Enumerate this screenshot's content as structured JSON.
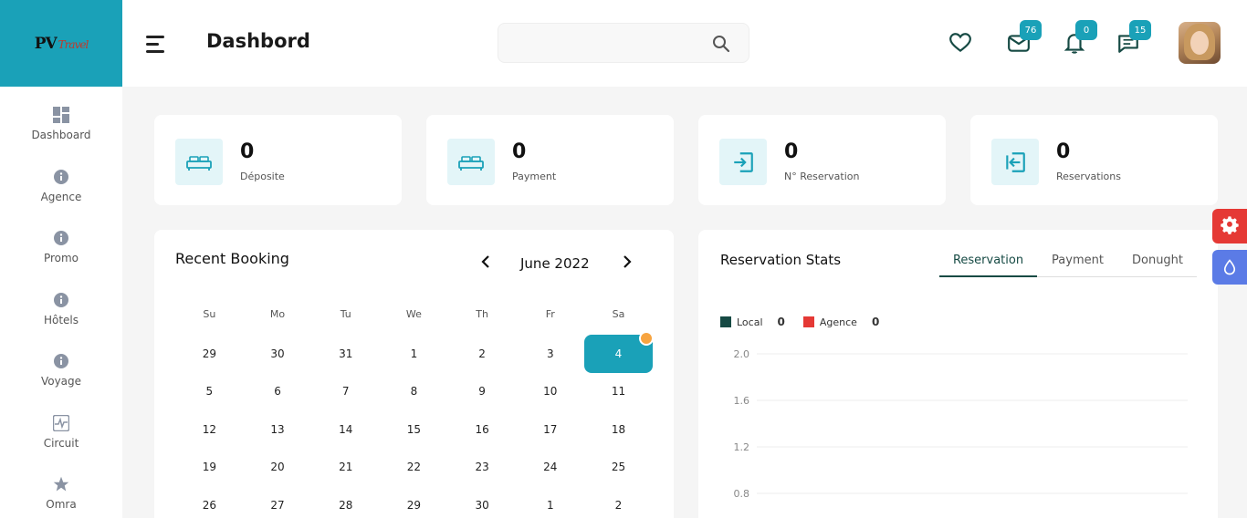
{
  "brand": {
    "logo_text": "PV",
    "logo_script": "Travel",
    "color": "#1aa1b8"
  },
  "header": {
    "title": "Dashbord",
    "search_placeholder": "",
    "icons": [
      {
        "name": "heart-icon",
        "badge": ""
      },
      {
        "name": "mail-icon",
        "badge": "76"
      },
      {
        "name": "bell-icon",
        "badge": "0"
      },
      {
        "name": "chat-icon",
        "badge": "15"
      }
    ]
  },
  "sidebar": {
    "items": [
      {
        "label": "Dashboard",
        "icon": "dashboard-grid-icon"
      },
      {
        "label": "Agence",
        "icon": "info-icon"
      },
      {
        "label": "Promo",
        "icon": "info-icon"
      },
      {
        "label": "Hôtels",
        "icon": "info-icon"
      },
      {
        "label": "Voyage",
        "icon": "info-icon"
      },
      {
        "label": "Circuit",
        "icon": "pulse-icon"
      },
      {
        "label": "Omra",
        "icon": "star-icon"
      }
    ]
  },
  "stats_cards": [
    {
      "value": "0",
      "label": "Déposite",
      "icon": "bed-icon"
    },
    {
      "value": "0",
      "label": "Payment",
      "icon": "bed-icon"
    },
    {
      "value": "0",
      "label": "N° Reservation",
      "icon": "login-icon"
    },
    {
      "value": "0",
      "label": "Reservations",
      "icon": "logout-icon"
    }
  ],
  "booking": {
    "title": "Recent Booking",
    "month": "June 2022",
    "weekdays": [
      "Su",
      "Mo",
      "Tu",
      "We",
      "Th",
      "Fr",
      "Sa"
    ],
    "weeks": [
      [
        "29",
        "30",
        "31",
        "1",
        "2",
        "3",
        "4"
      ],
      [
        "5",
        "6",
        "7",
        "8",
        "9",
        "10",
        "11"
      ],
      [
        "12",
        "13",
        "14",
        "15",
        "16",
        "17",
        "18"
      ],
      [
        "19",
        "20",
        "21",
        "22",
        "23",
        "24",
        "25"
      ],
      [
        "26",
        "27",
        "28",
        "29",
        "30",
        "1",
        "2"
      ]
    ],
    "selected_day": "4"
  },
  "reservation_stats": {
    "title": "Reservation Stats",
    "tabs": [
      "Reservation",
      "Payment",
      "Donught"
    ],
    "active_tab": "Reservation",
    "legend": [
      {
        "name": "Local",
        "value": "0",
        "color": "#164a44"
      },
      {
        "name": "Agence",
        "value": "0",
        "color": "#e53935"
      }
    ]
  },
  "chart_data": {
    "type": "line",
    "y_ticks": [
      "2.0",
      "1.6",
      "1.2",
      "0.8"
    ],
    "series": [
      {
        "name": "Local",
        "values": []
      },
      {
        "name": "Agence",
        "values": []
      }
    ],
    "grid": true
  },
  "floating_buttons": [
    {
      "name": "settings-gear-icon",
      "color": "#e53935"
    },
    {
      "name": "theme-drop-icon",
      "color": "#5b7be6"
    }
  ]
}
